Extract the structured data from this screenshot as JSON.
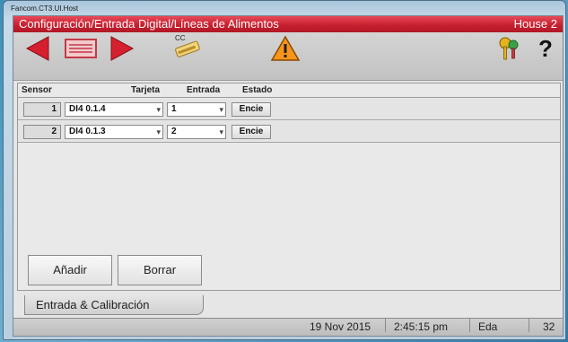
{
  "window": {
    "title": "Fancom.CT3.UI.Host"
  },
  "header": {
    "title": "Configuración/Entrada Digital/Líneas de Alimentos",
    "house": "House 2"
  },
  "toolbar": {
    "prev_icon": "arrow-left-icon",
    "list_icon": "list-icon",
    "next_icon": "arrow-right-icon",
    "cc_label": "CC",
    "cc_icon": "cc-tool-icon",
    "warning_icon": "warning-icon",
    "keys_icon": "keys-icon",
    "help_label": "?",
    "accent": "#d5202f"
  },
  "table": {
    "headers": {
      "sensor": "Sensor",
      "tarjeta": "Tarjeta",
      "entrada": "Entrada",
      "estado": "Estado"
    },
    "rows": [
      {
        "sensor": "1",
        "tarjeta": "DI4 0.1.4",
        "entrada": "1",
        "estado": "Encie"
      },
      {
        "sensor": "2",
        "tarjeta": "DI4 0.1.3",
        "entrada": "2",
        "estado": "Encie"
      }
    ]
  },
  "actions": {
    "add": "Añadir",
    "delete": "Borrar"
  },
  "tab": {
    "label": "Entrada & Calibración"
  },
  "status": {
    "date": "19 Nov 2015",
    "time": "2:45:15 pm",
    "label": "Eda",
    "value": "32"
  }
}
